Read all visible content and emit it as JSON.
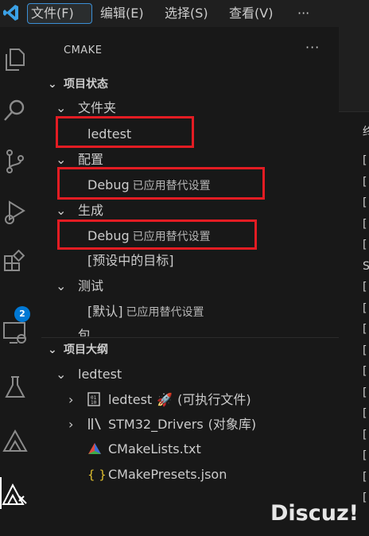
{
  "menu": [
    "文件(F)",
    "编辑(E)",
    "选择(S)",
    "查看(V)",
    "···"
  ],
  "sidebar": {
    "title": "CMAKE",
    "more": "···",
    "project_status": {
      "header": "项目状态",
      "folder": {
        "label": "文件夹",
        "value": "ledtest"
      },
      "configure": {
        "label": "配置",
        "value": "Debug",
        "desc": "已应用替代设置"
      },
      "build": {
        "label": "生成",
        "value": "Debug",
        "desc": "已应用替代设置",
        "target": "[预设中的目标]"
      },
      "test": {
        "label": "测试",
        "value": "[默认]",
        "desc": "已应用替代设置"
      },
      "package": {
        "label": "包"
      }
    },
    "project_outline": {
      "header": "项目大纲",
      "project": "ledtest",
      "items": [
        {
          "name": "ledtest",
          "desc": "(可执行文件)",
          "icon": "binary-file-icon",
          "extra_icon": "rocket-icon"
        },
        {
          "name": "STM32_Drivers",
          "desc": "(对象库)",
          "icon": "library-icon"
        },
        {
          "name": "CMakeLists.txt",
          "icon": "cmake-file-icon"
        },
        {
          "name": "CMakePresets.json",
          "icon": "json-file-icon"
        }
      ]
    }
  },
  "activity": {
    "extensions_badge": "2"
  },
  "editor": {
    "partial_char": "终",
    "brackets": [
      "[",
      "[",
      "[",
      "[",
      "[",
      "S",
      "[",
      "[",
      "[",
      "[",
      "[",
      "[",
      "[",
      "[",
      "[",
      "[",
      "["
    ]
  },
  "watermark": "Discuz!"
}
